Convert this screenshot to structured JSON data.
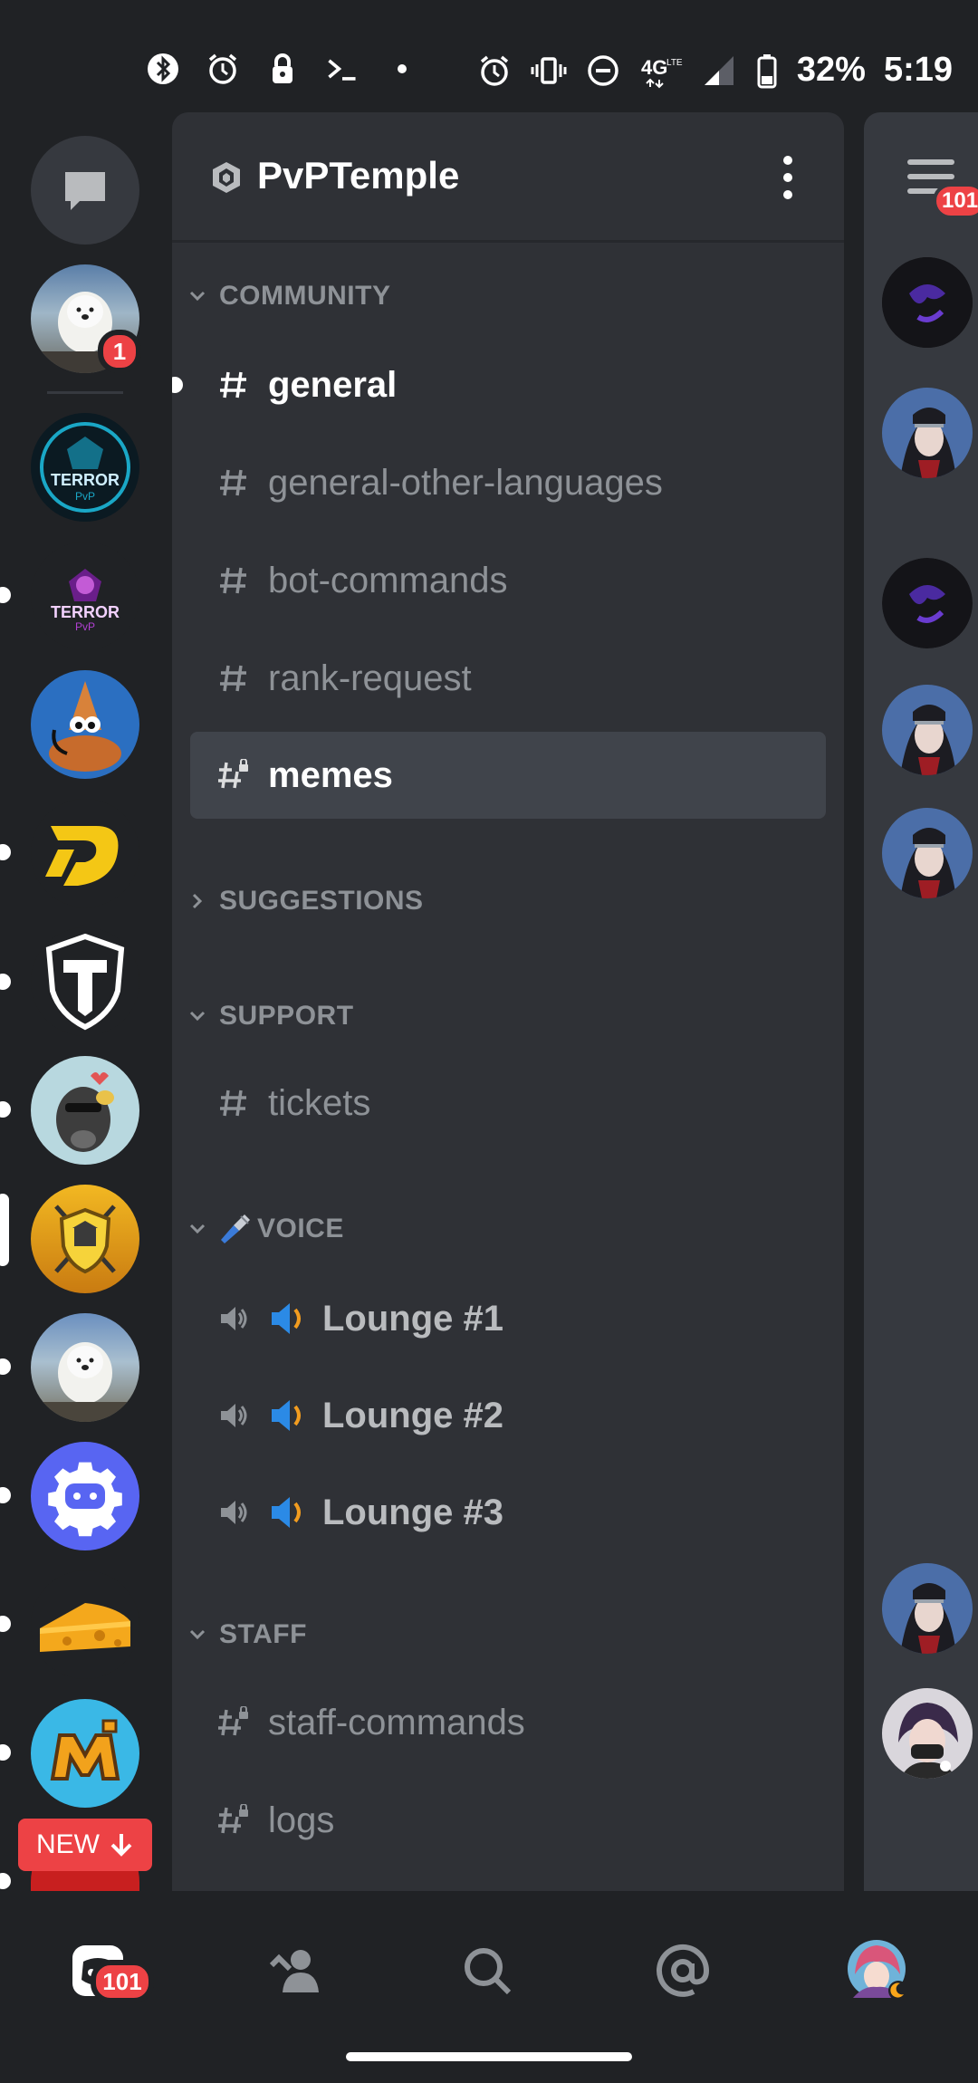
{
  "status_bar": {
    "battery": "32%",
    "time": "5:19",
    "network": "4G",
    "icons_left": [
      "bluetooth-icon",
      "alarm-icon",
      "lock-icon",
      "terminal-icon",
      "dot-icon"
    ],
    "icons_right": [
      "alarm-icon",
      "vibrate-icon",
      "do-not-disturb-icon",
      "network-4g-icon",
      "signal-icon",
      "battery-icon"
    ]
  },
  "rail": {
    "dm_label": "Direct Messages",
    "mention_badge": "1",
    "new_label": "NEW",
    "servers": [
      "samoyed",
      "terror-pvp-blue",
      "terror-pvp-purple",
      "cartoon-duck",
      "d-logo",
      "t-shield",
      "blob-sunglasses",
      "pvptemple-shield",
      "samoyed-2",
      "discord-gear",
      "cheese",
      "minecraft-m"
    ]
  },
  "guild": {
    "name": "PvPTemple"
  },
  "categories": {
    "community": "COMMUNITY",
    "suggestions": "SUGGESTIONS",
    "support": "SUPPORT",
    "voice": "VOICE",
    "staff": "STAFF"
  },
  "channels": {
    "general": "general",
    "general_other": "general-other-languages",
    "bot_commands": "bot-commands",
    "rank_request": "rank-request",
    "memes": "memes",
    "tickets": "tickets",
    "lounge1": "Lounge #1",
    "lounge2": "Lounge #2",
    "lounge3": "Lounge #3",
    "staff_commands": "staff-commands",
    "logs": "logs"
  },
  "peek": {
    "menu_badge": "101"
  },
  "nav": {
    "home_badge": "101",
    "items": [
      "home-icon",
      "friends-icon",
      "search-icon",
      "mentions-icon",
      "profile-avatar"
    ]
  },
  "colors": {
    "background": "#202225",
    "panel": "#2f3136",
    "selected": "#40444b",
    "badge": "#ed4245",
    "muted_text": "#8e9297"
  }
}
